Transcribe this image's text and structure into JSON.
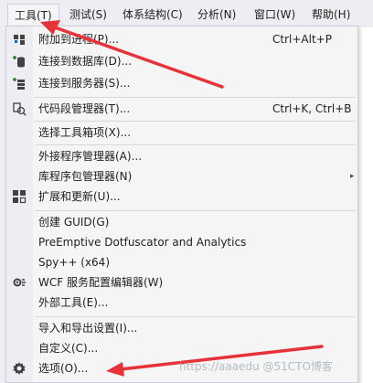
{
  "menubar": {
    "items": [
      {
        "label": "工具(T)"
      },
      {
        "label": "测试(S)"
      },
      {
        "label": "体系结构(C)"
      },
      {
        "label": "分析(N)"
      },
      {
        "label": "窗口(W)"
      },
      {
        "label": "帮助(H)"
      }
    ]
  },
  "menu": {
    "items": [
      {
        "label": "附加到进程(P)...",
        "shortcut": "Ctrl+Alt+P",
        "icon": "attach-process-icon"
      },
      {
        "label": "连接到数据库(D)...",
        "shortcut": "",
        "icon": "connect-database-icon"
      },
      {
        "label": "连接到服务器(S)...",
        "shortcut": "",
        "icon": "connect-server-icon"
      },
      {
        "label": "代码段管理器(T)...",
        "shortcut": "Ctrl+K, Ctrl+B",
        "icon": "snippets-manager-icon"
      },
      {
        "label": "选择工具箱项(X)...",
        "shortcut": "",
        "icon": ""
      },
      {
        "label": "外接程序管理器(A)...",
        "shortcut": "",
        "icon": ""
      },
      {
        "label": "库程序包管理器(N)",
        "shortcut": "",
        "icon": "",
        "submenu": true
      },
      {
        "label": "扩展和更新(U)...",
        "shortcut": "",
        "icon": "extensions-icon"
      },
      {
        "label": "创建 GUID(G)",
        "shortcut": "",
        "icon": ""
      },
      {
        "label": "PreEmptive Dotfuscator and Analytics",
        "shortcut": "",
        "icon": ""
      },
      {
        "label": "Spy++ (x64)",
        "shortcut": "",
        "icon": ""
      },
      {
        "label": "WCF 服务配置编辑器(W)",
        "shortcut": "",
        "icon": "wcf-config-icon"
      },
      {
        "label": "外部工具(E)...",
        "shortcut": "",
        "icon": ""
      },
      {
        "label": "导入和导出设置(I)...",
        "shortcut": "",
        "icon": ""
      },
      {
        "label": "自定义(C)...",
        "shortcut": "",
        "icon": ""
      },
      {
        "label": "选项(O)...",
        "shortcut": "",
        "icon": "gear-icon"
      }
    ],
    "submenu_glyph": "▸"
  },
  "watermark": "https://aaaedu @51CTO博客",
  "colors": {
    "menubar": "#eeeef2",
    "menu_bg": "#f5f5f5",
    "arrow": "#e8323a",
    "icon_blue": "#1e63b5",
    "icon_green": "#388a34"
  }
}
